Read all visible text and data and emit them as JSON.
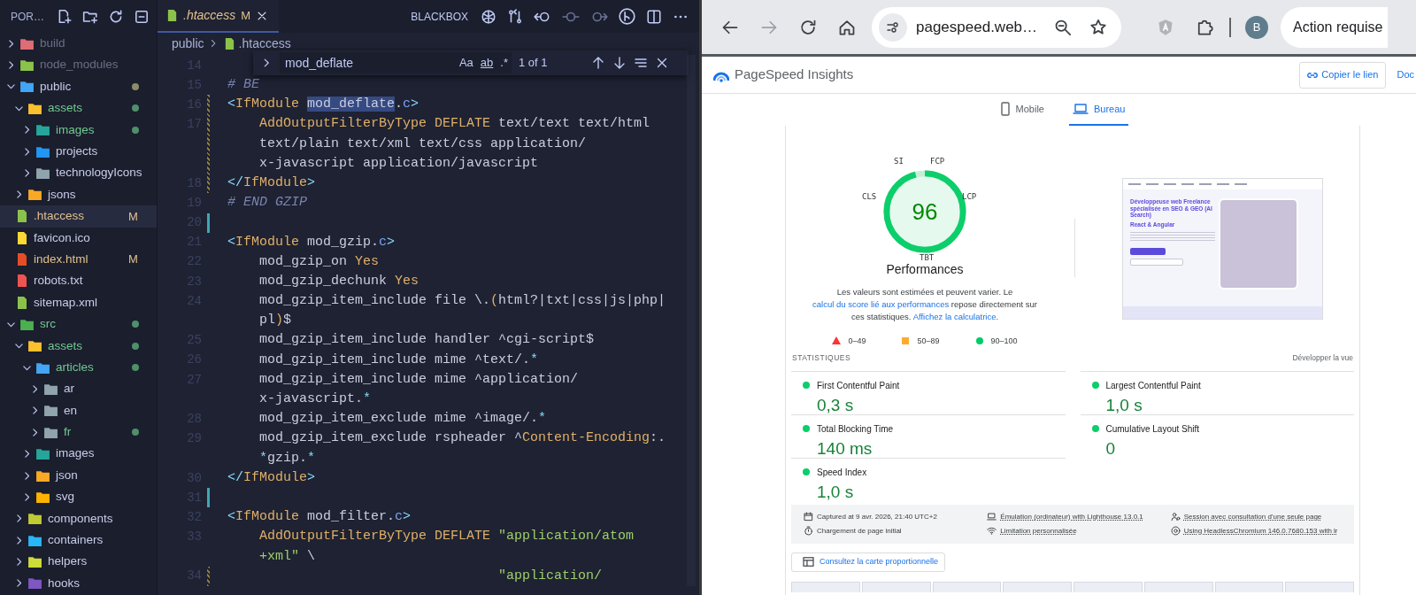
{
  "explorer": {
    "title": "POR…",
    "items": [
      {
        "label": "build",
        "kind": "folder",
        "expanded": false,
        "ignored": true,
        "untracked": false,
        "modified": false,
        "dot": false,
        "selected": false,
        "color": "#e06c75"
      },
      {
        "label": "node_modules",
        "kind": "folder",
        "expanded": false,
        "ignored": true,
        "untracked": false,
        "modified": false,
        "dot": false,
        "selected": false,
        "color": "#8bc34a"
      },
      {
        "label": "public",
        "kind": "folder",
        "expanded": true,
        "ignored": false,
        "untracked": false,
        "modified": false,
        "dot": true,
        "selected": false,
        "color": "#42a5f5",
        "children": [
          {
            "label": "assets",
            "kind": "folder",
            "expanded": true,
            "ignored": false,
            "untracked": true,
            "modified": false,
            "dot": true,
            "selected": false,
            "color": "#fbc02d",
            "children": [
              {
                "label": "images",
                "kind": "folder",
                "expanded": false,
                "ignored": false,
                "untracked": true,
                "modified": false,
                "dot": true,
                "selected": false,
                "color": "#26a69a"
              },
              {
                "label": "projects",
                "kind": "folder",
                "expanded": false,
                "ignored": false,
                "untracked": false,
                "modified": false,
                "dot": false,
                "selected": false,
                "color": "#2196f3"
              },
              {
                "label": "technologyIcons",
                "kind": "folder",
                "expanded": false,
                "ignored": false,
                "untracked": false,
                "modified": false,
                "dot": false,
                "selected": false,
                "color": "#90a4ae"
              }
            ]
          },
          {
            "label": "jsons",
            "kind": "folder",
            "expanded": false,
            "ignored": false,
            "untracked": false,
            "modified": false,
            "dot": false,
            "selected": false,
            "color": "#f9a825"
          },
          {
            "label": ".htaccess",
            "kind": "file",
            "ignored": false,
            "untracked": false,
            "modified": true,
            "dot": false,
            "badge": "M",
            "selected": true,
            "color": "#8bc34a"
          },
          {
            "label": "favicon.ico",
            "kind": "file",
            "ignored": false,
            "untracked": false,
            "modified": false,
            "dot": false,
            "selected": false,
            "color": "#fdd835"
          },
          {
            "label": "index.html",
            "kind": "file",
            "ignored": false,
            "untracked": false,
            "modified": true,
            "dot": false,
            "badge": "M",
            "selected": false,
            "color": "#e44d26"
          },
          {
            "label": "robots.txt",
            "kind": "file",
            "ignored": false,
            "untracked": false,
            "modified": false,
            "dot": false,
            "selected": false,
            "color": "#ef5350"
          },
          {
            "label": "sitemap.xml",
            "kind": "file",
            "ignored": false,
            "untracked": false,
            "modified": false,
            "dot": false,
            "selected": false,
            "color": "#8bc34a"
          }
        ]
      },
      {
        "label": "src",
        "kind": "folder",
        "expanded": true,
        "ignored": false,
        "untracked": true,
        "modified": false,
        "dot": true,
        "selected": false,
        "color": "#4caf50",
        "children": [
          {
            "label": "assets",
            "kind": "folder",
            "expanded": true,
            "ignored": false,
            "untracked": true,
            "modified": false,
            "dot": true,
            "selected": false,
            "color": "#fbc02d",
            "children": [
              {
                "label": "articles",
                "kind": "folder",
                "expanded": true,
                "ignored": false,
                "untracked": true,
                "modified": false,
                "dot": true,
                "selected": false,
                "color": "#42a5f5",
                "children": [
                  {
                    "label": "ar",
                    "kind": "folder",
                    "expanded": false,
                    "ignored": false,
                    "untracked": false,
                    "modified": false,
                    "dot": false,
                    "selected": false,
                    "color": "#90a4ae"
                  },
                  {
                    "label": "en",
                    "kind": "folder",
                    "expanded": false,
                    "ignored": false,
                    "untracked": false,
                    "modified": false,
                    "dot": false,
                    "selected": false,
                    "color": "#90a4ae"
                  },
                  {
                    "label": "fr",
                    "kind": "folder",
                    "expanded": false,
                    "ignored": false,
                    "untracked": true,
                    "modified": false,
                    "dot": true,
                    "selected": false,
                    "color": "#90a4ae"
                  }
                ]
              },
              {
                "label": "images",
                "kind": "folder",
                "expanded": false,
                "ignored": false,
                "untracked": false,
                "modified": false,
                "dot": false,
                "selected": false,
                "color": "#26a69a"
              },
              {
                "label": "json",
                "kind": "folder",
                "expanded": false,
                "ignored": false,
                "untracked": false,
                "modified": false,
                "dot": false,
                "selected": false,
                "color": "#f9a825"
              },
              {
                "label": "svg",
                "kind": "folder",
                "expanded": false,
                "ignored": false,
                "untracked": false,
                "modified": false,
                "dot": false,
                "selected": false,
                "color": "#ffb300"
              }
            ]
          },
          {
            "label": "components",
            "kind": "folder",
            "expanded": false,
            "ignored": false,
            "untracked": false,
            "modified": false,
            "dot": false,
            "selected": false,
            "color": "#c0ca33"
          },
          {
            "label": "containers",
            "kind": "folder",
            "expanded": false,
            "ignored": false,
            "untracked": false,
            "modified": false,
            "dot": false,
            "selected": false,
            "color": "#29b6f6"
          },
          {
            "label": "helpers",
            "kind": "folder",
            "expanded": false,
            "ignored": false,
            "untracked": false,
            "modified": false,
            "dot": false,
            "selected": false,
            "color": "#cddc39"
          },
          {
            "label": "hooks",
            "kind": "folder",
            "expanded": false,
            "ignored": false,
            "untracked": false,
            "modified": false,
            "dot": false,
            "selected": false,
            "color": "#7e57c2"
          }
        ]
      }
    ]
  },
  "editor": {
    "tab": {
      "label": ".htaccess",
      "badge": "M",
      "selected": true
    },
    "toolbar_label": "BLACKBOX",
    "breadcrumb": [
      "public",
      ".htaccess"
    ],
    "find": {
      "query": "mod_deflate",
      "options": [
        "Aa",
        "ab",
        ".*"
      ],
      "count": "1 of 1"
    },
    "lines": [
      {
        "number": "14",
        "added": false,
        "modified": false
      },
      {
        "number": "15",
        "added": false,
        "modified": false,
        "tokens": [
          {
            "kind": "comment",
            "text": "# BE"
          }
        ]
      },
      {
        "number": "16",
        "added": false,
        "modified": true,
        "tokens": [
          {
            "kind": "op",
            "text": "<"
          },
          {
            "kind": "name",
            "text": "IfModule "
          },
          {
            "kind": "match",
            "text": "mod_deflate"
          },
          {
            "kind": "plain",
            "text": "."
          },
          {
            "kind": "ext",
            "text": "c"
          },
          {
            "kind": "op",
            "text": ">"
          }
        ]
      },
      {
        "number": "17",
        "added": false,
        "modified": true,
        "tokens": [
          {
            "kind": "directive",
            "text": "    AddOutputFilterByType "
          },
          {
            "kind": "value",
            "text": "DEFLATE"
          },
          {
            "kind": "plain",
            "text": " text/text text/html"
          }
        ]
      },
      {
        "added": false,
        "modified": true,
        "tokens": [
          {
            "kind": "plain",
            "text": "    text/plain text/xml text/css application/"
          }
        ]
      },
      {
        "added": false,
        "modified": true,
        "tokens": [
          {
            "kind": "plain",
            "text": "    x-javascript application/javascript"
          }
        ]
      },
      {
        "number": "18",
        "added": false,
        "modified": true,
        "tokens": [
          {
            "kind": "op",
            "text": "</"
          },
          {
            "kind": "name",
            "text": "IfModule"
          },
          {
            "kind": "op",
            "text": ">"
          }
        ]
      },
      {
        "number": "19",
        "added": false,
        "modified": false,
        "tokens": [
          {
            "kind": "comment",
            "text": "# END GZIP"
          }
        ]
      },
      {
        "number": "20",
        "added": true,
        "modified": false
      },
      {
        "number": "21",
        "added": false,
        "modified": false,
        "tokens": [
          {
            "kind": "op",
            "text": "<"
          },
          {
            "kind": "name",
            "text": "IfModule"
          },
          {
            "kind": "plain",
            "text": " mod_gzip."
          },
          {
            "kind": "ext",
            "text": "c"
          },
          {
            "kind": "op",
            "text": ">"
          }
        ]
      },
      {
        "number": "22",
        "added": false,
        "modified": false,
        "tokens": [
          {
            "kind": "plain",
            "text": "    mod_gzip_on "
          },
          {
            "kind": "value",
            "text": "Yes"
          }
        ]
      },
      {
        "number": "23",
        "added": false,
        "modified": false,
        "tokens": [
          {
            "kind": "plain",
            "text": "    mod_gzip_dechunk "
          },
          {
            "kind": "value",
            "text": "Yes"
          }
        ]
      },
      {
        "number": "24",
        "added": false,
        "modified": false,
        "tokens": [
          {
            "kind": "plain",
            "text": "    mod_gzip_item_include file \\."
          },
          {
            "kind": "value",
            "text": "("
          },
          {
            "kind": "plain",
            "text": "html?|txt|css|js|php|"
          }
        ]
      },
      {
        "added": false,
        "modified": false,
        "tokens": [
          {
            "kind": "plain",
            "text": "    pl"
          },
          {
            "kind": "value",
            "text": ")"
          },
          {
            "kind": "plain",
            "text": "$"
          }
        ]
      },
      {
        "number": "25",
        "added": false,
        "modified": false,
        "tokens": [
          {
            "kind": "plain",
            "text": "    mod_gzip_item_include handler ^cgi-script$"
          }
        ]
      },
      {
        "number": "26",
        "added": false,
        "modified": false,
        "tokens": [
          {
            "kind": "plain",
            "text": "    mod_gzip_item_include mime ^text/."
          },
          {
            "kind": "op",
            "text": "*"
          }
        ]
      },
      {
        "number": "27",
        "added": false,
        "modified": false,
        "tokens": [
          {
            "kind": "plain",
            "text": "    mod_gzip_item_include mime ^application/"
          }
        ]
      },
      {
        "added": false,
        "modified": false,
        "tokens": [
          {
            "kind": "plain",
            "text": "    x-javascript."
          },
          {
            "kind": "op",
            "text": "*"
          }
        ]
      },
      {
        "number": "28",
        "added": false,
        "modified": false,
        "tokens": [
          {
            "kind": "plain",
            "text": "    mod_gzip_item_exclude mime ^image/."
          },
          {
            "kind": "op",
            "text": "*"
          }
        ]
      },
      {
        "number": "29",
        "added": false,
        "modified": false,
        "tokens": [
          {
            "kind": "plain",
            "text": "    mod_gzip_item_exclude rspheader ^"
          },
          {
            "kind": "directive",
            "text": "Content-Encoding"
          },
          {
            "kind": "plain",
            "text": ":."
          }
        ]
      },
      {
        "added": false,
        "modified": false,
        "tokens": [
          {
            "kind": "op",
            "text": "    *"
          },
          {
            "kind": "plain",
            "text": "gzip."
          },
          {
            "kind": "op",
            "text": "*"
          }
        ]
      },
      {
        "number": "30",
        "added": false,
        "modified": false,
        "tokens": [
          {
            "kind": "op",
            "text": "</"
          },
          {
            "kind": "name",
            "text": "IfModule"
          },
          {
            "kind": "op",
            "text": ">"
          }
        ]
      },
      {
        "number": "31",
        "added": true,
        "modified": false
      },
      {
        "number": "32",
        "added": false,
        "modified": false,
        "tokens": [
          {
            "kind": "op",
            "text": "<"
          },
          {
            "kind": "name",
            "text": "IfModule"
          },
          {
            "kind": "plain",
            "text": " mod_filter."
          },
          {
            "kind": "ext",
            "text": "c"
          },
          {
            "kind": "op",
            "text": ">"
          }
        ]
      },
      {
        "number": "33",
        "added": false,
        "modified": false,
        "tokens": [
          {
            "kind": "directive",
            "text": "    AddOutputFilterByType "
          },
          {
            "kind": "value",
            "text": "DEFLATE"
          },
          {
            "kind": "string",
            "text": " \"application/atom"
          }
        ]
      },
      {
        "added": false,
        "modified": false,
        "tokens": [
          {
            "kind": "string",
            "text": "    +xml\""
          },
          {
            "kind": "plain",
            "text": " \\"
          }
        ]
      },
      {
        "number": "34",
        "added": false,
        "modified": true,
        "tokens": [
          {
            "kind": "string",
            "text": "                                  \"application/"
          }
        ]
      }
    ]
  },
  "browser": {
    "address": "pagespeed.web…",
    "avatar": "B",
    "action": "Action requise",
    "page": {
      "title": "PageSpeed Insights",
      "share_button": "Copier le lien",
      "docs_link": "Doc",
      "device_tabs": [
        {
          "label": "Mobile",
          "kind": "phone",
          "selected": false
        },
        {
          "label": "Bureau",
          "kind": "laptop",
          "selected": true
        }
      ],
      "gauge": {
        "score": "96",
        "level": 0.96,
        "labels": [
          "SI",
          "FCP",
          "LCP",
          "CLS",
          "TBT"
        ],
        "title": "Performances"
      },
      "description": [
        {
          "text": "Les valeurs sont estimées et peuvent varier. Le ",
          "link": false
        },
        {
          "text": "calcul du score lié aux performances",
          "link": true
        },
        {
          "text": " repose directement sur ces statistiques. ",
          "link": false
        },
        {
          "text": "Affichez la calculatrice",
          "link": true
        },
        {
          "text": ".",
          "link": false
        }
      ],
      "legend": [
        {
          "kind": "triangle",
          "label": "0–49",
          "color": "#ff3333"
        },
        {
          "kind": "square",
          "label": "50–89",
          "color": "#ffaa33"
        },
        {
          "kind": "circle",
          "label": "90–100",
          "color": "#00cc66"
        }
      ],
      "preview": {
        "headline": "Développeuse web Freelance spécialisée en SEO & GEO (AI Search)",
        "subheading": "React & Angular"
      },
      "stats_title": "STATISTIQUES",
      "expand_link": "Développer la vue",
      "metrics": [
        {
          "label": "First Contentful Paint",
          "value": "0,3 s",
          "color": "#0cce6b"
        },
        {
          "label": "Largest Contentful Paint",
          "value": "1,0 s",
          "color": "#0cce6b"
        },
        {
          "label": "Total Blocking Time",
          "value": "140 ms",
          "color": "#0cce6b"
        },
        {
          "label": "Cumulative Layout Shift",
          "value": "0",
          "color": "#0cce6b"
        },
        {
          "label": "Speed Index",
          "value": "1,0 s",
          "color": "#0cce6b"
        }
      ],
      "environment": [
        {
          "kind": "calendar",
          "text": "Captured at 9 avr. 2026, 21:40 UTC+2",
          "link": false
        },
        {
          "kind": "laptop",
          "text": "Émulation (ordinateur) with Lighthouse 13.0.1",
          "link": true
        },
        {
          "kind": "person",
          "text": "Session avec consultation d’une seule page",
          "link": true
        },
        {
          "kind": "timer",
          "text": "Chargement de page initial",
          "link": false
        },
        {
          "kind": "wifi",
          "text": "Limitation personnalisée",
          "link": true
        },
        {
          "kind": "browser",
          "text": "Using HeadlessChromium 146.0.7680.153 with lr",
          "link": true
        }
      ],
      "map_button": "Consultez la carte proportionnelle"
    }
  }
}
